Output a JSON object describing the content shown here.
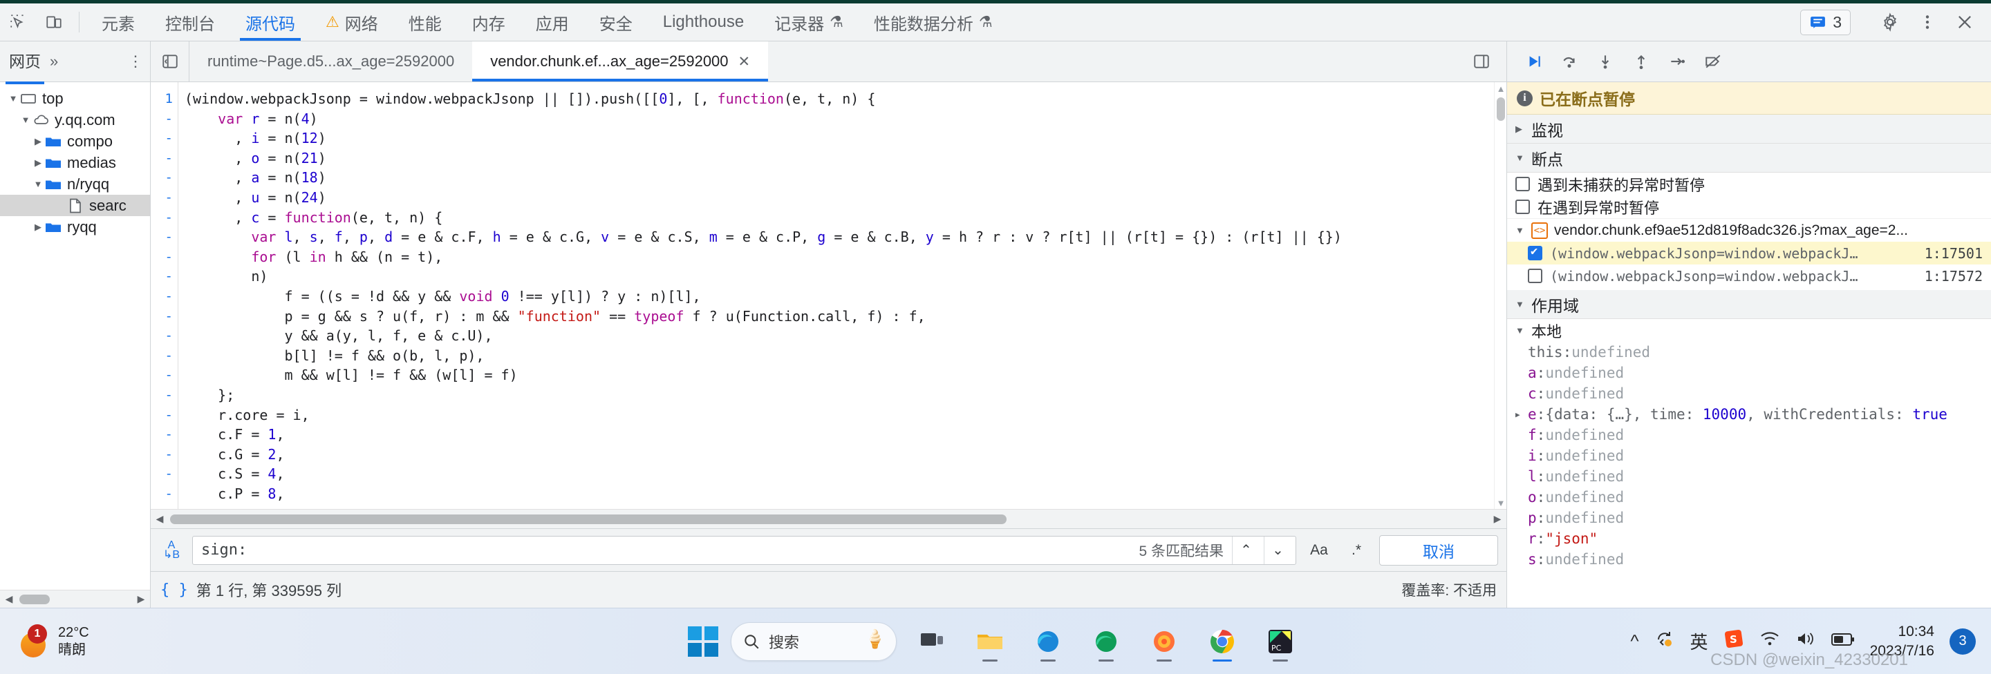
{
  "devtools": {
    "main_tabs": [
      {
        "label": "元素",
        "active": false,
        "icon": null
      },
      {
        "label": "控制台",
        "active": false,
        "icon": null
      },
      {
        "label": "源代码",
        "active": true,
        "icon": null
      },
      {
        "label": "网络",
        "active": false,
        "icon": "warning-triangle-icon"
      },
      {
        "label": "性能",
        "active": false,
        "icon": null
      },
      {
        "label": "内存",
        "active": false,
        "icon": null
      },
      {
        "label": "应用",
        "active": false,
        "icon": null
      },
      {
        "label": "安全",
        "active": false,
        "icon": null
      },
      {
        "label": "Lighthouse",
        "active": false,
        "icon": null
      },
      {
        "label": "记录器",
        "active": false,
        "icon": "flask-icon"
      },
      {
        "label": "性能数据分析",
        "active": false,
        "icon": "flask-icon"
      }
    ],
    "issues_count": "3",
    "accent_color": "#1a73e8"
  },
  "navigator": {
    "tab_label": "网页",
    "more_label": "»",
    "tree": [
      {
        "label": "top",
        "depth": 0,
        "twisty": "▼",
        "icon": "frame-icon",
        "selected": false
      },
      {
        "label": "y.qq.com",
        "depth": 1,
        "twisty": "▼",
        "icon": "cloud-icon",
        "selected": false
      },
      {
        "label": "compo",
        "depth": 2,
        "twisty": "▶",
        "icon": "folder-icon",
        "selected": false
      },
      {
        "label": "medias",
        "depth": 2,
        "twisty": "▶",
        "icon": "folder-icon",
        "selected": false
      },
      {
        "label": "n/ryqq",
        "depth": 2,
        "twisty": "▼",
        "icon": "folder-icon",
        "selected": false
      },
      {
        "label": "searc",
        "depth": 3,
        "twisty": "",
        "icon": "file-icon",
        "selected": true
      },
      {
        "label": "ryqq",
        "depth": 2,
        "twisty": "▶",
        "icon": "folder-icon",
        "selected": false
      }
    ]
  },
  "file_tabs": [
    {
      "label": "runtime~Page.d5...ax_age=2592000",
      "active": false,
      "closable": false
    },
    {
      "label": "vendor.chunk.ef...ax_age=2592000",
      "active": true,
      "closable": true
    }
  ],
  "editor": {
    "first_line_number": "1",
    "fold_marker": "-",
    "lines": [
      [
        {
          "t": "(window.webpackJsonp = window.webpackJsonp || []).push([[",
          "c": ""
        },
        {
          "t": "0",
          "c": "num"
        },
        {
          "t": "], [, ",
          "c": ""
        },
        {
          "t": "function",
          "c": "fn"
        },
        {
          "t": "(e, t, n) {",
          "c": ""
        }
      ],
      [
        {
          "t": "    ",
          "c": ""
        },
        {
          "t": "var",
          "c": "fn"
        },
        {
          "t": " ",
          "c": ""
        },
        {
          "t": "r",
          "c": "vr"
        },
        {
          "t": " = n(",
          "c": ""
        },
        {
          "t": "4",
          "c": "num"
        },
        {
          "t": ")",
          "c": ""
        }
      ],
      [
        {
          "t": "      , ",
          "c": ""
        },
        {
          "t": "i",
          "c": "vr"
        },
        {
          "t": " = n(",
          "c": ""
        },
        {
          "t": "12",
          "c": "num"
        },
        {
          "t": ")",
          "c": ""
        }
      ],
      [
        {
          "t": "      , ",
          "c": ""
        },
        {
          "t": "o",
          "c": "vr"
        },
        {
          "t": " = n(",
          "c": ""
        },
        {
          "t": "21",
          "c": "num"
        },
        {
          "t": ")",
          "c": ""
        }
      ],
      [
        {
          "t": "      , ",
          "c": ""
        },
        {
          "t": "a",
          "c": "vr"
        },
        {
          "t": " = n(",
          "c": ""
        },
        {
          "t": "18",
          "c": "num"
        },
        {
          "t": ")",
          "c": ""
        }
      ],
      [
        {
          "t": "      , ",
          "c": ""
        },
        {
          "t": "u",
          "c": "vr"
        },
        {
          "t": " = n(",
          "c": ""
        },
        {
          "t": "24",
          "c": "num"
        },
        {
          "t": ")",
          "c": ""
        }
      ],
      [
        {
          "t": "      , ",
          "c": ""
        },
        {
          "t": "c",
          "c": "vr"
        },
        {
          "t": " = ",
          "c": ""
        },
        {
          "t": "function",
          "c": "fn"
        },
        {
          "t": "(e, t, n) {",
          "c": ""
        }
      ],
      [
        {
          "t": "        ",
          "c": ""
        },
        {
          "t": "var",
          "c": "fn"
        },
        {
          "t": " ",
          "c": ""
        },
        {
          "t": "l",
          "c": "vr"
        },
        {
          "t": ", ",
          "c": ""
        },
        {
          "t": "s",
          "c": "vr"
        },
        {
          "t": ", ",
          "c": ""
        },
        {
          "t": "f",
          "c": "vr"
        },
        {
          "t": ", ",
          "c": ""
        },
        {
          "t": "p",
          "c": "vr"
        },
        {
          "t": ", ",
          "c": ""
        },
        {
          "t": "d",
          "c": "vr"
        },
        {
          "t": " = e & c.F, ",
          "c": ""
        },
        {
          "t": "h",
          "c": "vr"
        },
        {
          "t": " = e & c.G, ",
          "c": ""
        },
        {
          "t": "v",
          "c": "vr"
        },
        {
          "t": " = e & c.S, ",
          "c": ""
        },
        {
          "t": "m",
          "c": "vr"
        },
        {
          "t": " = e & c.P, ",
          "c": ""
        },
        {
          "t": "g",
          "c": "vr"
        },
        {
          "t": " = e & c.B, ",
          "c": ""
        },
        {
          "t": "y",
          "c": "vr"
        },
        {
          "t": " = h ? r : v ? r[t] || (r[t] = {}) : (r[t] || {})",
          "c": ""
        }
      ],
      [
        {
          "t": "        ",
          "c": ""
        },
        {
          "t": "for",
          "c": "fn"
        },
        {
          "t": " (l ",
          "c": ""
        },
        {
          "t": "in",
          "c": "fn"
        },
        {
          "t": " h && (n = t),",
          "c": ""
        }
      ],
      [
        {
          "t": "        n)",
          "c": ""
        }
      ],
      [
        {
          "t": "            f = ((s = !d && y && ",
          "c": ""
        },
        {
          "t": "void",
          "c": "fn"
        },
        {
          "t": " ",
          "c": ""
        },
        {
          "t": "0",
          "c": "num"
        },
        {
          "t": " !== y[l]) ? y : n)[l],",
          "c": ""
        }
      ],
      [
        {
          "t": "            p = g && s ? u(f, r) : m && ",
          "c": ""
        },
        {
          "t": "\"function\"",
          "c": "str"
        },
        {
          "t": " == ",
          "c": ""
        },
        {
          "t": "typeof",
          "c": "fn"
        },
        {
          "t": " f ? u(Function.call, f) : f,",
          "c": ""
        }
      ],
      [
        {
          "t": "            y && a(y, l, f, e & c.U),",
          "c": ""
        }
      ],
      [
        {
          "t": "            b[l] != f && o(b, l, p),",
          "c": ""
        }
      ],
      [
        {
          "t": "            m && w[l] != f && (w[l] = f)",
          "c": ""
        }
      ],
      [
        {
          "t": "    };",
          "c": ""
        }
      ],
      [
        {
          "t": "    r.core = i,",
          "c": ""
        }
      ],
      [
        {
          "t": "    c.F = ",
          "c": ""
        },
        {
          "t": "1",
          "c": "num"
        },
        {
          "t": ",",
          "c": ""
        }
      ],
      [
        {
          "t": "    c.G = ",
          "c": ""
        },
        {
          "t": "2",
          "c": "num"
        },
        {
          "t": ",",
          "c": ""
        }
      ],
      [
        {
          "t": "    c.S = ",
          "c": ""
        },
        {
          "t": "4",
          "c": "num"
        },
        {
          "t": ",",
          "c": ""
        }
      ],
      [
        {
          "t": "    c.P = ",
          "c": ""
        },
        {
          "t": "8",
          "c": "num"
        },
        {
          "t": ",",
          "c": ""
        }
      ]
    ]
  },
  "search": {
    "value": "sign:",
    "match_count": "5 条匹配结果",
    "prev_icon": "chevron-up-icon",
    "next_icon": "chevron-down-icon",
    "match_case_label": "Aa",
    "regex_label": ".*",
    "cancel_label": "取消"
  },
  "status": {
    "position": "第 1 行, 第 339595 列",
    "coverage": "覆盖率: 不适用"
  },
  "debugger": {
    "paused_text": "已在断点暂停",
    "sections": {
      "watch": "监视",
      "breakpoints": "断点",
      "scope": "作用域"
    },
    "pause_options": [
      {
        "label": "遇到未捕获的异常时暂停",
        "checked": false
      },
      {
        "label": "在遇到异常时暂停",
        "checked": false
      }
    ],
    "breakpoint_file": "vendor.chunk.ef9ae512d819f8adc326.js?max_age=2...",
    "breakpoint_items": [
      {
        "label": "(window.webpackJsonp=window.webpackJ…",
        "location": "1:17501",
        "checked": true,
        "highlighted": true
      },
      {
        "label": "(window.webpackJsonp=window.webpackJ…",
        "location": "1:17572",
        "checked": false,
        "highlighted": false
      }
    ],
    "scope_name": "本地",
    "scope_vars": [
      {
        "name": "this",
        "value": "undefined",
        "kind": "undef",
        "plain": true,
        "expandable": false
      },
      {
        "name": "a",
        "value": "undefined",
        "kind": "undef",
        "plain": false,
        "expandable": false
      },
      {
        "name": "c",
        "value": "undefined",
        "kind": "undef",
        "plain": false,
        "expandable": false
      },
      {
        "name": "e",
        "value": "{data: {…}, time: 10000, withCredentials: true",
        "kind": "obj",
        "plain": false,
        "expandable": true
      },
      {
        "name": "f",
        "value": "undefined",
        "kind": "undef",
        "plain": false,
        "expandable": false
      },
      {
        "name": "i",
        "value": "undefined",
        "kind": "undef",
        "plain": false,
        "expandable": false
      },
      {
        "name": "l",
        "value": "undefined",
        "kind": "undef",
        "plain": false,
        "expandable": false
      },
      {
        "name": "o",
        "value": "undefined",
        "kind": "undef",
        "plain": false,
        "expandable": false
      },
      {
        "name": "p",
        "value": "undefined",
        "kind": "undef",
        "plain": false,
        "expandable": false
      },
      {
        "name": "r",
        "value": "\"json\"",
        "kind": "str",
        "plain": false,
        "expandable": false
      },
      {
        "name": "s",
        "value": "undefined",
        "kind": "undef",
        "plain": false,
        "expandable": false
      }
    ]
  },
  "taskbar": {
    "weather_temp": "22°C",
    "weather_desc": "晴朗",
    "weather_badge": "1",
    "search_placeholder": "搜索",
    "ime_label": "英",
    "clock_time": "10:34",
    "clock_date": "2023/7/16",
    "notification_count": "3"
  },
  "watermark": "CSDN @weixin_42330201"
}
